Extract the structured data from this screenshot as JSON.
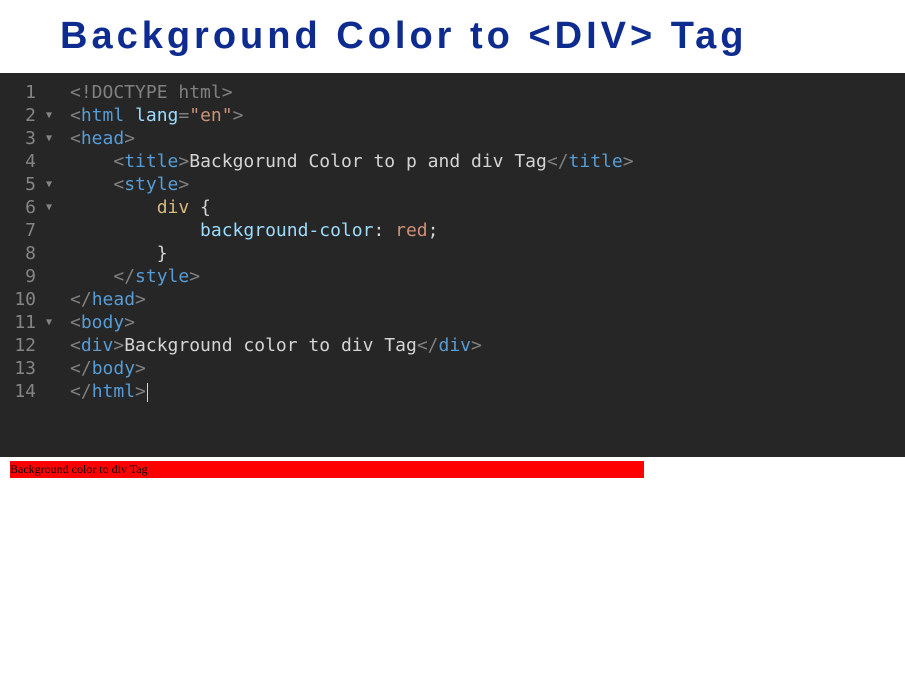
{
  "header": {
    "title": "Background Color to <DIV> Tag"
  },
  "editor": {
    "gutter": [
      {
        "num": "1",
        "fold": ""
      },
      {
        "num": "2",
        "fold": "▼"
      },
      {
        "num": "3",
        "fold": "▼"
      },
      {
        "num": "4",
        "fold": ""
      },
      {
        "num": "5",
        "fold": "▼"
      },
      {
        "num": "6",
        "fold": "▼"
      },
      {
        "num": "7",
        "fold": ""
      },
      {
        "num": "8",
        "fold": ""
      },
      {
        "num": "9",
        "fold": ""
      },
      {
        "num": "10",
        "fold": ""
      },
      {
        "num": "11",
        "fold": "▼"
      },
      {
        "num": "12",
        "fold": ""
      },
      {
        "num": "13",
        "fold": ""
      },
      {
        "num": "14",
        "fold": ""
      }
    ],
    "code": {
      "line1_doctype": "<!DOCTYPE html>",
      "line2_open": "<",
      "line2_tag": "html",
      "line2_attr": " lang",
      "line2_eq": "=",
      "line2_val": "\"en\"",
      "line2_close": ">",
      "line3_open": "<",
      "line3_tag": "head",
      "line3_close": ">",
      "line4_indent": "    ",
      "line4_open": "<",
      "line4_tag": "title",
      "line4_close1": ">",
      "line4_text": "Backgorund Color to p and div Tag",
      "line4_open2": "</",
      "line4_tag2": "title",
      "line4_close2": ">",
      "line5_indent": "    ",
      "line5_open": "<",
      "line5_tag": "style",
      "line5_close": ">",
      "line6_indent": "        ",
      "line6_sel": "div",
      "line6_brace": " {",
      "line7_indent": "            ",
      "line7_prop": "background-color",
      "line7_colon": ": ",
      "line7_val": "red",
      "line7_semi": ";",
      "line8_indent": "        ",
      "line8_brace": "}",
      "line9_indent": "    ",
      "line9_open": "</",
      "line9_tag": "style",
      "line9_close": ">",
      "line10_open": "</",
      "line10_tag": "head",
      "line10_close": ">",
      "line11_open": "<",
      "line11_tag": "body",
      "line11_close": ">",
      "line12_open": "<",
      "line12_tag": "div",
      "line12_close1": ">",
      "line12_text": "Background color to div Tag",
      "line12_open2": "</",
      "line12_tag2": "div",
      "line12_close2": ">",
      "line13_open": "</",
      "line13_tag": "body",
      "line13_close": ">",
      "line14_open": "</",
      "line14_tag": "html",
      "line14_close": ">"
    }
  },
  "preview": {
    "div_text": "Background color to div Tag"
  }
}
